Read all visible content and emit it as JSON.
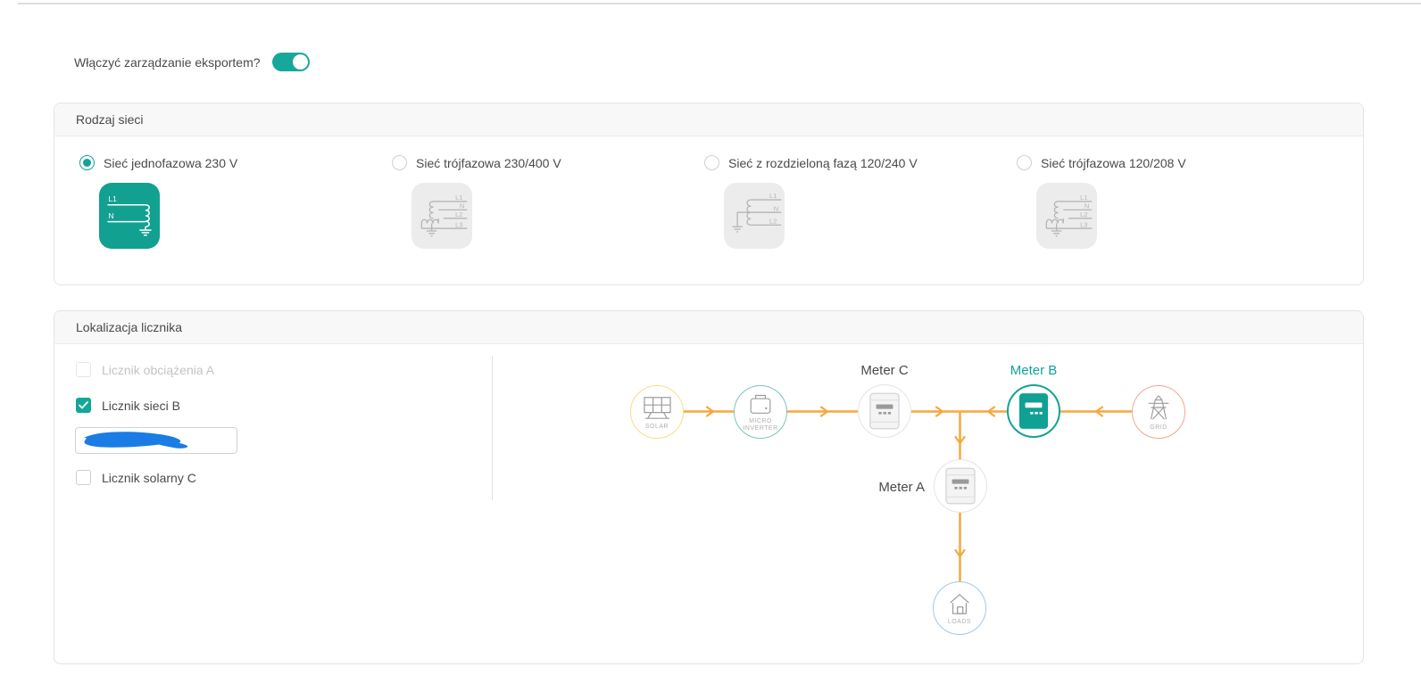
{
  "colors": {
    "accent_teal": "#12A296",
    "toggle_teal": "#15A89B",
    "flow_orange": "#F5A83C",
    "solar_yellow": "#F2E086",
    "inverter_teal": "#7CC4BD",
    "grid_salmon": "#F0A68F",
    "loads_blue": "#A4C6F0",
    "scribble_blue": "#1B7CE5"
  },
  "export_toggle": {
    "label": "Włączyć zarządzanie eksportem?",
    "state": "on"
  },
  "grid_type_panel": {
    "title": "Rodzaj sieci",
    "options": [
      {
        "label": "Sieć jednofazowa 230 V",
        "selected": true
      },
      {
        "label": "Sieć trójfazowa 230/400 V",
        "selected": false
      },
      {
        "label": "Sieć z rozdzieloną fazą 120/240 V",
        "selected": false
      },
      {
        "label": "Sieć trójfazowa 120/208 V",
        "selected": false
      }
    ],
    "phase_labels": {
      "single": {
        "l1": "L1",
        "n": "N"
      },
      "three": {
        "l1": "L1",
        "n": "N",
        "l2": "L2",
        "l3": "L3"
      },
      "split": {
        "l1": "L1",
        "n": "N",
        "l2": "L2"
      }
    }
  },
  "meter_location_panel": {
    "title": "Lokalizacja licznika",
    "checkboxes": [
      {
        "label": "Licznik obciążenia A",
        "checked": false,
        "disabled": true
      },
      {
        "label": "Licznik sieci B",
        "checked": true,
        "disabled": false
      },
      {
        "label": "Licznik solarny C",
        "checked": false,
        "disabled": false
      }
    ],
    "meter_b_serial_input": {
      "value": "",
      "redacted_by_scribble": true
    }
  },
  "diagram": {
    "nodes": [
      {
        "id": "solar",
        "inner_label": "SOLAR"
      },
      {
        "id": "micro-inverter",
        "inner_label_line1": "MICRO",
        "inner_label_line2": "INVERTER"
      },
      {
        "id": "meter-c",
        "outer_label": "Meter C"
      },
      {
        "id": "meter-b",
        "outer_label": "Meter B",
        "highlighted": true
      },
      {
        "id": "grid",
        "inner_label": "GRID"
      },
      {
        "id": "meter-a",
        "outer_label": "Meter A"
      },
      {
        "id": "loads",
        "inner_label": "LOADS"
      }
    ]
  }
}
